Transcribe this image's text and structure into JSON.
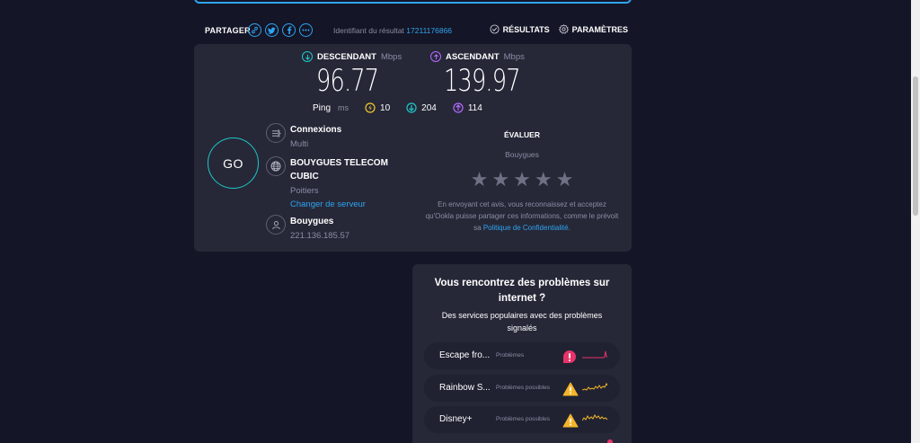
{
  "share": {
    "label": "PARTAGER",
    "icons": [
      "link-icon",
      "twitter-icon",
      "facebook-icon",
      "more-icon"
    ],
    "result_id_label": "Identifiant du résultat",
    "result_id": "17211176866"
  },
  "nav": {
    "results_label": "RÉSULTATS",
    "settings_label": "PARAMÈTRES"
  },
  "download": {
    "label": "DESCENDANT",
    "unit": "Mbps",
    "value": "96.77"
  },
  "upload": {
    "label": "ASCENDANT",
    "unit": "Mbps",
    "value": "139.97"
  },
  "ping": {
    "label": "Ping",
    "unit": "ms",
    "idle": "10",
    "download": "204",
    "upload": "114"
  },
  "go_label": "GO",
  "connections": {
    "title": "Connexions",
    "value": "Multi"
  },
  "server": {
    "name": "BOUYGUES TELECOM CUBIC",
    "location": "Poitiers",
    "change_label": "Changer de serveur"
  },
  "provider": {
    "name": "Bouygues",
    "ip": "221.136.185.57"
  },
  "rate": {
    "title": "ÉVALUER",
    "provider": "Bouygues",
    "stars": 5,
    "note_text": "En envoyant cet avis, vous reconnaissez et acceptez qu'Ookla puisse partager ces informations, comme le prévoit sa ",
    "policy_link": "Politique de Confidentialité",
    "note_end": "."
  },
  "problems": {
    "title": "Vous rencontrez des problèmes sur internet ?",
    "subtitle": "Des services populaires avec des problèmes signalés",
    "items": [
      {
        "name": "Escape fro...",
        "status": "Problèmes",
        "level": "problem"
      },
      {
        "name": "Rainbow S...",
        "status": "Problèmes possibles",
        "level": "warning"
      },
      {
        "name": "Disney+",
        "status": "Problèmes possibles",
        "level": "warning"
      }
    ]
  },
  "colors": {
    "background": "#141526",
    "card": "#262838",
    "accent_blue": "#2fa4f0",
    "download_cyan": "#1fc7c7",
    "upload_purple": "#b36bff",
    "ping_yellow": "#f5c82a",
    "problem_red": "#e8336a",
    "warning_amber": "#f5b52a"
  }
}
